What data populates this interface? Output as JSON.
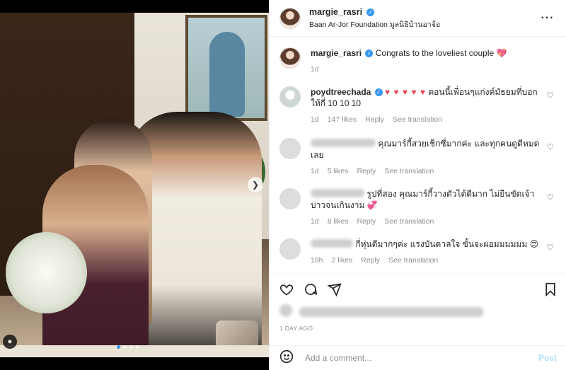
{
  "post": {
    "author": "margie_rasri",
    "location": "Baan Ar-Jor Foundation มูลนิธิบ้านอาจ้อ",
    "more_icon": "more-options-icon"
  },
  "caption": {
    "username": "margie_rasri",
    "text": "Congrats to the loveliest couple",
    "emoji": "💖",
    "time": "1d"
  },
  "comments": [
    {
      "username": "poydtreechada",
      "verified": true,
      "hearts": "♥ ♥ ♥ ♥ ♥",
      "text": "ตอนนี้เพื่อนๆแก่งค์มัธยมที่บอกให้กี่ 10 10 10",
      "time": "1d",
      "likes": "147 likes",
      "reply": "Reply",
      "translate": "See translation"
    },
    {
      "username_hidden": true,
      "text": "คุณมาร์กี้สวยเช็กซี่มากค่ะ และทุกคนดูดีหมดเลย",
      "time": "1d",
      "likes": "5 likes",
      "reply": "Reply",
      "translate": "See translation"
    },
    {
      "username_hidden": true,
      "text": "รูปที่สอง คุณมาร์กี้วางตัวได้ดีมาก ไม่ยืนขัดเจ้าบ่าวจนเกินงาม",
      "emoji": "💞",
      "time": "1d",
      "likes": "8 likes",
      "reply": "Reply",
      "translate": "See translation"
    },
    {
      "username_hidden": true,
      "text": "กี่หุ่นดีมากๆค่ะ แรงบันดาลใจ ขั้นจะผอมมมมมม",
      "emoji": "😍",
      "time": "19h",
      "likes": "2 likes",
      "reply": "Reply",
      "translate": "See translation"
    }
  ],
  "actions": {
    "like_icon": "heart-icon",
    "comment_icon": "comment-icon",
    "share_icon": "share-icon",
    "save_icon": "bookmark-icon"
  },
  "time_ago": "1 DAY AGO",
  "add_comment": {
    "placeholder": "Add a comment...",
    "post_label": "Post"
  },
  "media": {
    "next_icon": "chevron-right-icon",
    "tag_icon": "user-tag-icon",
    "carousel_count": 4,
    "carousel_active": 1
  }
}
